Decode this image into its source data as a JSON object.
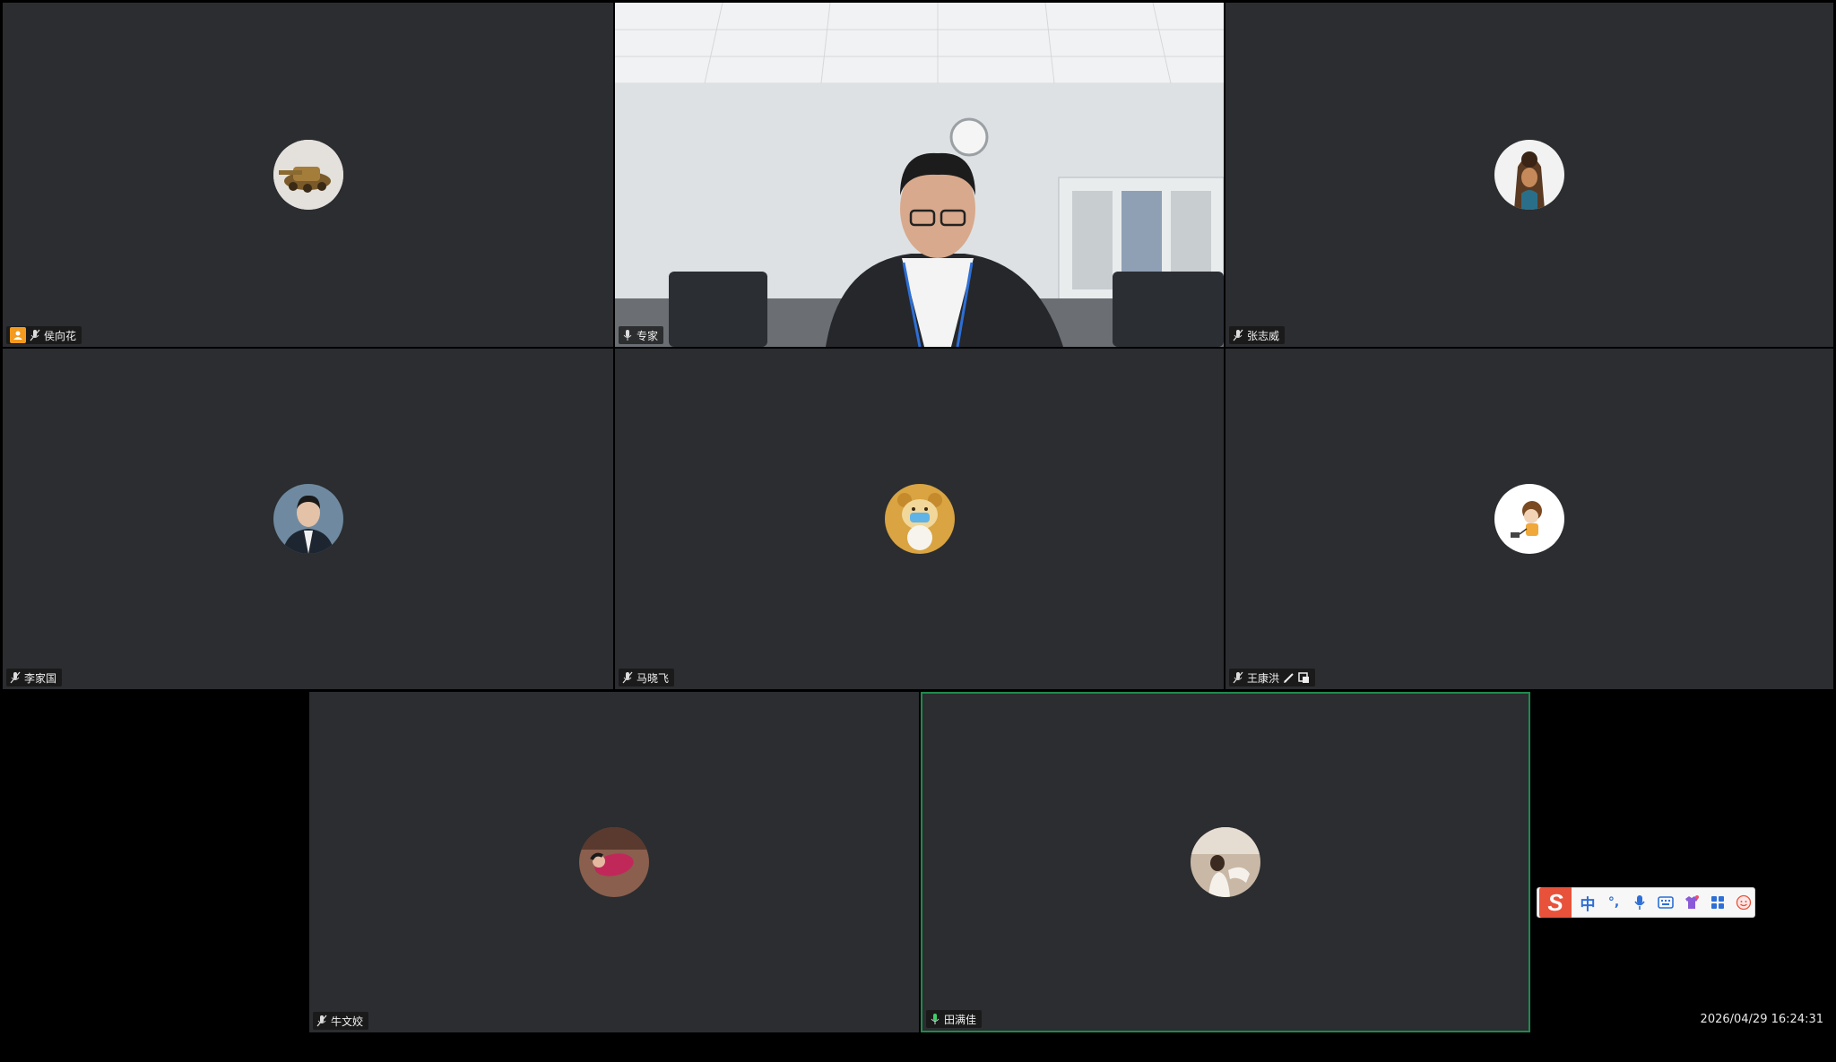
{
  "participants": [
    {
      "name": "侯向花",
      "host": true,
      "avatar_icon": "tank-avatar-icon"
    },
    {
      "name": "专家",
      "video_on": true
    },
    {
      "name": "张志威",
      "avatar_icon": "figure-avatar-icon"
    },
    {
      "name": "李家国",
      "avatar_icon": "man-suit-avatar-icon"
    },
    {
      "name": "马晓飞",
      "avatar_icon": "bear-mask-avatar-icon"
    },
    {
      "name": "王康洪",
      "avatar_icon": "cartoon-avatar-icon",
      "extra_icons": [
        "pen-icon",
        "share-screen-icon"
      ]
    },
    {
      "name": "牛文姣",
      "avatar_icon": "portrait-avatar-icon"
    },
    {
      "name": "田满佳",
      "speaking": true,
      "avatar_icon": "scenery-avatar-icon"
    }
  ],
  "timestamp": "2026/04/29 16:24:31",
  "ime_toolbar": {
    "logo": "S",
    "lang": "中",
    "punct": "°,",
    "icons": [
      "microphone-icon",
      "keyboard-icon",
      "skin-icon",
      "apps-icon",
      "emoji-icon"
    ]
  },
  "colors": {
    "tile_bg": "#2b2d30",
    "speaking_border": "#1e8a4c",
    "host_badge": "#f39a1f"
  }
}
